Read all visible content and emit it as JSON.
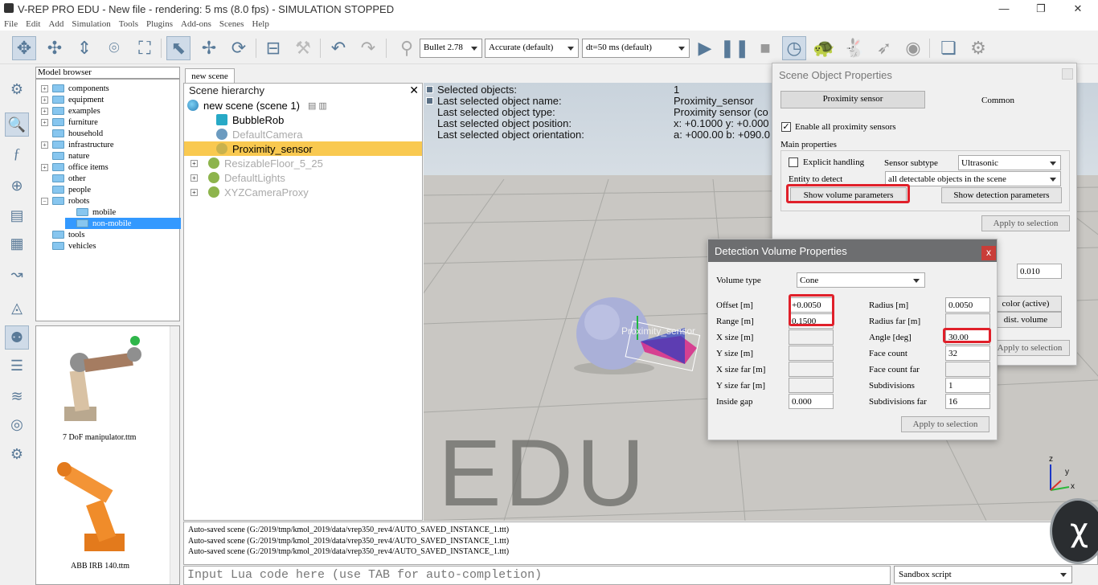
{
  "window": {
    "title": "V-REP PRO EDU - New file - rendering: 5 ms (8.0 fps) - SIMULATION STOPPED",
    "minimize": "—",
    "restore": "❐",
    "close": "✕"
  },
  "menu": [
    "File",
    "Edit",
    "Add",
    "Simulation",
    "Tools",
    "Plugins",
    "Add-ons",
    "Scenes",
    "Help"
  ],
  "toolbar": {
    "engine": "Bullet 2.78",
    "accuracy": "Accurate (default)",
    "timestep": "dt=50 ms (default)"
  },
  "model_browser": {
    "title": "Model browser",
    "items": [
      {
        "label": "components",
        "depth": 0,
        "expandable": true
      },
      {
        "label": "equipment",
        "depth": 0,
        "expandable": true
      },
      {
        "label": "examples",
        "depth": 0,
        "expandable": true
      },
      {
        "label": "furniture",
        "depth": 0,
        "expandable": true
      },
      {
        "label": "household",
        "depth": 0,
        "expandable": false
      },
      {
        "label": "infrastructure",
        "depth": 0,
        "expandable": true
      },
      {
        "label": "nature",
        "depth": 0,
        "expandable": false
      },
      {
        "label": "office items",
        "depth": 0,
        "expandable": true
      },
      {
        "label": "other",
        "depth": 0,
        "expandable": false
      },
      {
        "label": "people",
        "depth": 0,
        "expandable": false
      },
      {
        "label": "robots",
        "depth": 0,
        "expandable": true
      },
      {
        "label": "mobile",
        "depth": 1,
        "expandable": false
      },
      {
        "label": "non-mobile",
        "depth": 1,
        "expandable": false,
        "selected": true
      },
      {
        "label": "tools",
        "depth": 0,
        "expandable": false
      },
      {
        "label": "vehicles",
        "depth": 0,
        "expandable": false
      }
    ],
    "previews": [
      "7 DoF manipulator.ttm",
      "ABB IRB 140.ttm"
    ]
  },
  "scene_tab": "new scene",
  "scene_hierarchy": {
    "title": "Scene hierarchy",
    "root": "new scene (scene 1)",
    "items": [
      {
        "label": "BubbleRob",
        "dim": false,
        "selected": false,
        "expand": false
      },
      {
        "label": "DefaultCamera",
        "dim": true,
        "selected": false,
        "expand": false
      },
      {
        "label": "Proximity_sensor",
        "dim": false,
        "selected": true,
        "expand": false
      },
      {
        "label": "ResizableFloor_5_25",
        "dim": true,
        "selected": false,
        "expand": true
      },
      {
        "label": "DefaultLights",
        "dim": true,
        "selected": false,
        "expand": true
      },
      {
        "label": "XYZCameraProxy",
        "dim": true,
        "selected": false,
        "expand": true
      }
    ]
  },
  "viewport": {
    "info_labels": [
      "Selected objects:",
      "Last selected object name:",
      "Last selected object type:",
      "Last selected object position:",
      "Last selected object orientation:"
    ],
    "info_values": [
      "1",
      "Proximity_sensor",
      "Proximity sensor (co",
      "x: +0.1000    y: +0.000",
      "a: +000.00    b: +090.0"
    ],
    "sensor_label": "Proximity_sensor",
    "watermark": "EDU",
    "axes": {
      "z": "z",
      "y": "y",
      "x": "x"
    }
  },
  "console": {
    "lines": [
      "Auto-saved scene (G:/2019/tmp/kmol_2019/data/vrep350_rev4/AUTO_SAVED_INSTANCE_1.ttt)",
      "Auto-saved scene (G:/2019/tmp/kmol_2019/data/vrep350_rev4/AUTO_SAVED_INSTANCE_1.ttt)",
      "Auto-saved scene (G:/2019/tmp/kmol_2019/data/vrep350_rev4/AUTO_SAVED_INSTANCE_1.ttt)"
    ],
    "lua_placeholder": "Input Lua code here (use TAB for auto-completion)",
    "script_select": "Sandbox script"
  },
  "sop": {
    "title": "Scene Object Properties",
    "tab_active": "Proximity sensor",
    "tab_other": "Common",
    "enable_all": "Enable all proximity sensors",
    "main_props": "Main properties",
    "explicit": "Explicit handling",
    "subtype_label": "Sensor subtype",
    "subtype_value": "Ultrasonic",
    "entity_label": "Entity to detect",
    "entity_value": "all detectable objects in the scene",
    "show_volume": "Show volume parameters",
    "show_detection": "Show detection parameters",
    "apply": "Apply to selection",
    "partial_value": "0.010",
    "partial_color": "color (active)",
    "partial_dist": "dist. volume",
    "partial_apply": "Apply to selection"
  },
  "dvp": {
    "title": "Detection Volume Properties",
    "close": "x",
    "volume_type_label": "Volume type",
    "volume_type": "Cone",
    "left": [
      {
        "label": "Offset [m]",
        "value": "+0.0050",
        "disabled": false
      },
      {
        "label": "Range [m]",
        "value": "0.1500",
        "disabled": false
      },
      {
        "label": "X size [m]",
        "value": "",
        "disabled": true
      },
      {
        "label": "Y size [m]",
        "value": "",
        "disabled": true
      },
      {
        "label": "X size far [m]",
        "value": "",
        "disabled": true
      },
      {
        "label": "Y size far [m]",
        "value": "",
        "disabled": true
      },
      {
        "label": "Inside gap",
        "value": "0.000",
        "disabled": false
      }
    ],
    "right": [
      {
        "label": "Radius [m]",
        "value": "0.0050",
        "disabled": false
      },
      {
        "label": "Radius far [m]",
        "value": "",
        "disabled": true
      },
      {
        "label": "Angle [deg]",
        "value": "30.00",
        "disabled": false
      },
      {
        "label": "Face count",
        "value": "32",
        "disabled": false
      },
      {
        "label": "Face count far",
        "value": "",
        "disabled": true
      },
      {
        "label": "Subdivisions",
        "value": "1",
        "disabled": false
      },
      {
        "label": "Subdivisions far",
        "value": "16",
        "disabled": false
      }
    ],
    "apply": "Apply to selection"
  }
}
